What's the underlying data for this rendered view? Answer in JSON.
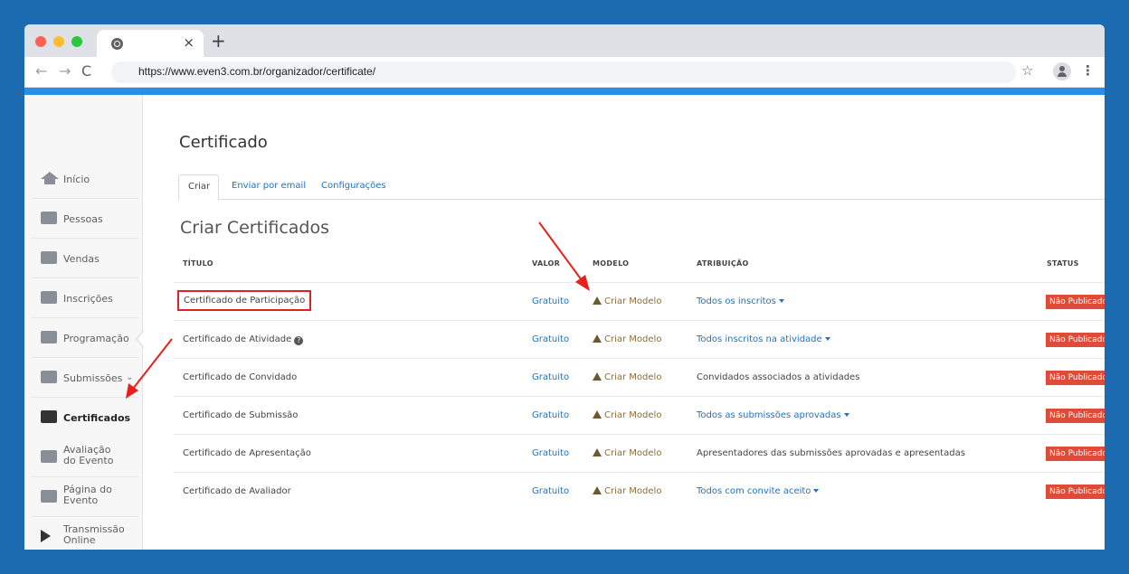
{
  "browser": {
    "url": "https://www.even3.com.br/organizador/certificate/",
    "tab_close": "×",
    "new_tab": "+",
    "back": "←",
    "forward": "→",
    "reload": "C",
    "star": "☆",
    "menu": "⋮"
  },
  "sidebar": {
    "items": [
      {
        "label": "Início",
        "icon": "home-icon"
      },
      {
        "label": "Pessoas",
        "icon": "people-icon"
      },
      {
        "label": "Vendas",
        "icon": "money-bag-icon"
      },
      {
        "label": "Inscrições",
        "icon": "ticket-icon"
      },
      {
        "label": "Programação",
        "icon": "calendar-icon"
      },
      {
        "label": "Submissões",
        "icon": "document-icon",
        "chevron": "⌄"
      },
      {
        "label": "Certificados",
        "icon": "certificate-icon",
        "active": true
      },
      {
        "label_line1": "Avaliação",
        "label_line2": "do Evento",
        "icon": "clipboard-icon"
      },
      {
        "label_line1": "Página do",
        "label_line2": "Evento",
        "icon": "browser-page-icon"
      },
      {
        "label_line1": "Transmissão",
        "label_line2": "Online",
        "icon": "play-icon"
      }
    ]
  },
  "main": {
    "page_title": "Certificado",
    "tabs": [
      {
        "label": "Criar",
        "active": true
      },
      {
        "label": "Enviar por email"
      },
      {
        "label": "Configurações"
      }
    ],
    "section_title": "Criar Certificados",
    "table": {
      "headers": {
        "titulo": "TÍTULO",
        "valor": "VALOR",
        "modelo": "MODELO",
        "atribuicao": "ATRIBUIÇÃO",
        "status": "STATUS"
      },
      "rows": [
        {
          "titulo": "Certificado de Participação",
          "valor": "Gratuito",
          "modelo": "Criar Modelo",
          "atribuicao": "Todos os inscritos",
          "status": "Não Publicado"
        },
        {
          "titulo": "Certificado de Atividade",
          "valor": "Gratuito",
          "modelo": "Criar Modelo",
          "atribuicao": "Todos inscritos na atividade",
          "status": "Não Publicado"
        },
        {
          "titulo": "Certificado de Convidado",
          "valor": "Gratuito",
          "modelo": "Criar Modelo",
          "atribuicao": "Convidados associados a atividades",
          "status": "Não Publicado"
        },
        {
          "titulo": "Certificado de Submissão",
          "valor": "Gratuito",
          "modelo": "Criar Modelo",
          "atribuicao": "Todos as submissões aprovadas",
          "status": "Não Publicado"
        },
        {
          "titulo": "Certificado de Apresentação",
          "valor": "Gratuito",
          "modelo": "Criar Modelo",
          "atribuicao": "Apresentadores das submissões aprovadas e apresentadas",
          "status": "Não Publicado"
        },
        {
          "titulo": "Certificado de Avaliador",
          "valor": "Gratuito",
          "modelo": "Criar Modelo",
          "atribuicao": "Todos com convite aceito",
          "status": "Não Publicado"
        }
      ]
    }
  },
  "colors": {
    "background": "#1c6bb0",
    "accent_bar": "#2c8ee4",
    "link": "#1a73c8",
    "status_badge": "#dd4b39",
    "annotation": "#e8201b"
  }
}
